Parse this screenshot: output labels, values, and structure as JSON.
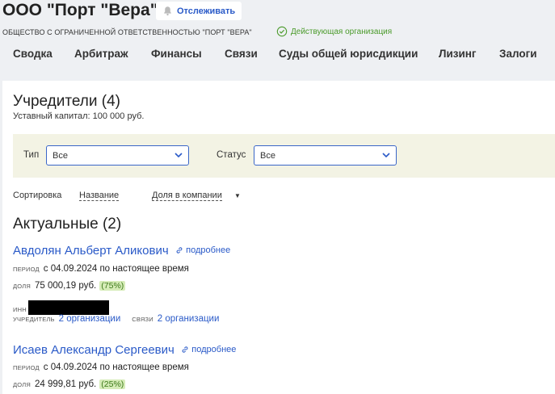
{
  "header": {
    "company_name": "ООО \"Порт \"Вера\"",
    "follow_label": "Отслеживать",
    "full_name": "ОБЩЕСТВО С ОГРАНИЧЕННОЙ ОТВЕТСТВЕННОСТЬЮ \"ПОРТ \"ВЕРА\"",
    "status": "Действующая организация",
    "status_color": "#4a9a2a"
  },
  "nav": {
    "tabs": [
      {
        "label": "Сводка"
      },
      {
        "label": "Арбитраж"
      },
      {
        "label": "Финансы"
      },
      {
        "label": "Связи"
      },
      {
        "label": "Суды общей юрисдикции"
      },
      {
        "label": "Лизинг"
      },
      {
        "label": "Залоги"
      }
    ]
  },
  "main": {
    "title": "Учредители (4)",
    "capital": "Уставный капитал: 100 000 руб.",
    "filters": {
      "type_label": "Тип",
      "type_value": "Все",
      "status_label": "Статус",
      "status_value": "Все"
    },
    "sort": {
      "label": "Сортировка",
      "by_name": "Название",
      "by_share": "Доля в компании"
    },
    "section_title": "Актуальные (2)",
    "more_label": "подробнее",
    "founders": [
      {
        "name": "Авдолян Альберт Аликович",
        "period_key": "период",
        "period": "с 04.09.2024 по настоящее время",
        "share_key": "доля",
        "share": "75 000,19 руб.",
        "share_pct": "(75%)",
        "inn_key": "инн",
        "founder_key": "учредитель",
        "founder_link": "2 организации",
        "links_key": "связи",
        "links_link": "2 организации"
      },
      {
        "name": "Исаев Александр Сергеевич",
        "period_key": "период",
        "period": "с 04.09.2024 по настоящее время",
        "share_key": "доля",
        "share": "24 999,81 руб.",
        "share_pct": "(25%)"
      }
    ]
  },
  "colors": {
    "accent": "#2a5ac8",
    "percent_bg": "#d6ecb8"
  }
}
